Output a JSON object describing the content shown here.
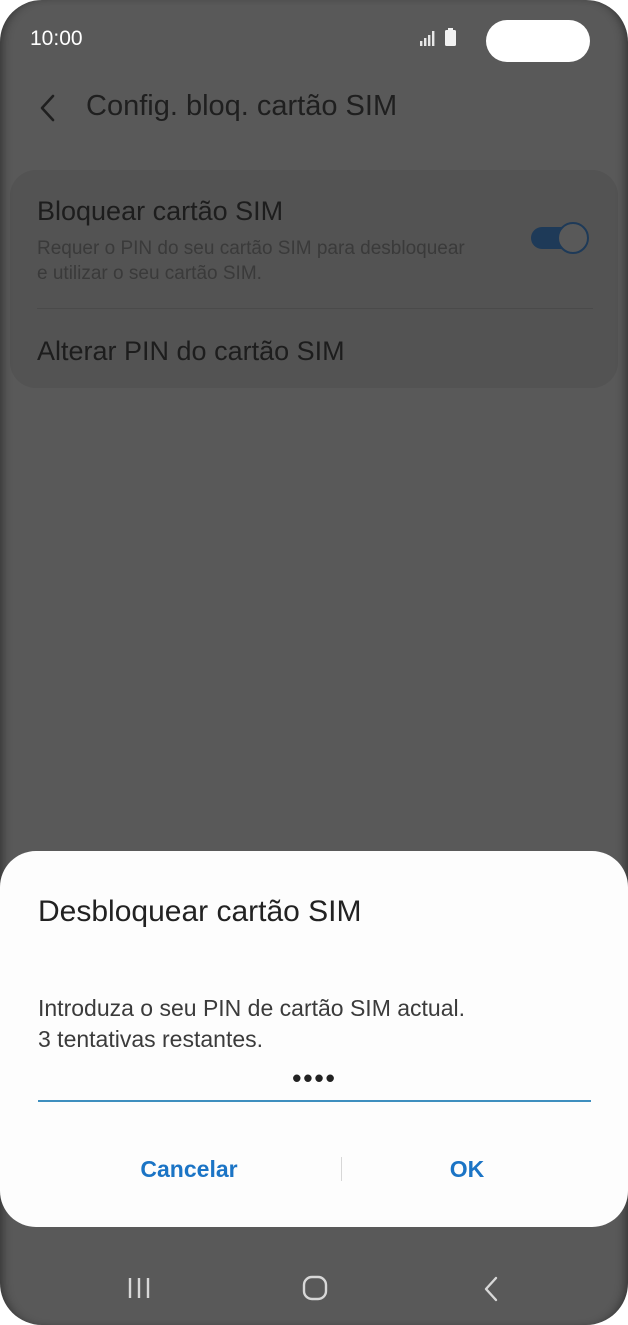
{
  "status_bar": {
    "time": "10:00",
    "signal_icon": "signal-bars-icon",
    "battery_icon": "battery-icon"
  },
  "header": {
    "title": "Config. bloq. cartão SIM",
    "back_icon": "chevron-left-icon"
  },
  "settings": {
    "lock_sim": {
      "title": "Bloquear cartão SIM",
      "description": "Requer o PIN do seu cartão SIM para desbloquear e utilizar o seu cartão SIM.",
      "enabled": true
    },
    "change_pin": {
      "title": "Alterar PIN do cartão SIM"
    }
  },
  "dialog": {
    "title": "Desbloquear cartão SIM",
    "message_line1": "Introduza o seu PIN de cartão SIM actual.",
    "message_line2": "3 tentativas restantes.",
    "pin_value": "••••",
    "cancel_label": "Cancelar",
    "ok_label": "OK"
  },
  "nav_bar": {
    "recents_icon": "recent-apps-icon",
    "home_icon": "home-icon",
    "back_icon": "back-chevron-icon"
  },
  "colors": {
    "accent": "#1b74c5",
    "input_underline": "#3e8fbf",
    "dimmed_background": "#595959",
    "dialog_background": "#fdfdfd"
  }
}
